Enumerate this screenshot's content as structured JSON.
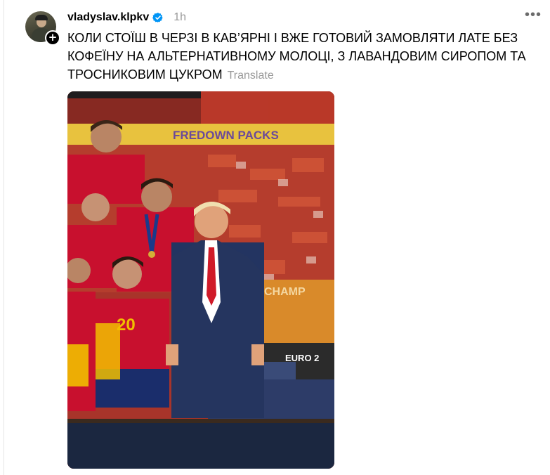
{
  "post": {
    "username": "vladyslav.klpkv",
    "time": "1h",
    "caption": "КОЛИ СТОЇШ В ЧЕРЗІ В КАВ’ЯРНІ І ВЖЕ ГОТОВИЙ ЗАМОВЛЯТИ ЛАТЕ БЕЗ КОФЕЇНУ НА АЛЬТЕРНАТИВНОМУ МОЛОЦІ, З ЛАВАНДОВИМ СИРОПОМ ТА ТРОСНИКОВИМ ЦУКРОМ",
    "translate_label": "Translate",
    "more_label": "•••",
    "follow_label": "+"
  },
  "photo": {
    "banner_text": "FREDOWN PACKS",
    "board_text": "CHAMP",
    "podium_text": "EURO 2",
    "jersey_number": "20"
  },
  "icons": {
    "verified": "verified-badge-icon",
    "more": "more-options-icon",
    "follow": "follow-plus-icon"
  },
  "colors": {
    "verified_blue": "#0095f6",
    "muted_text": "#999999",
    "spain_red": "#c8102e",
    "spain_yellow": "#f1bf00"
  }
}
